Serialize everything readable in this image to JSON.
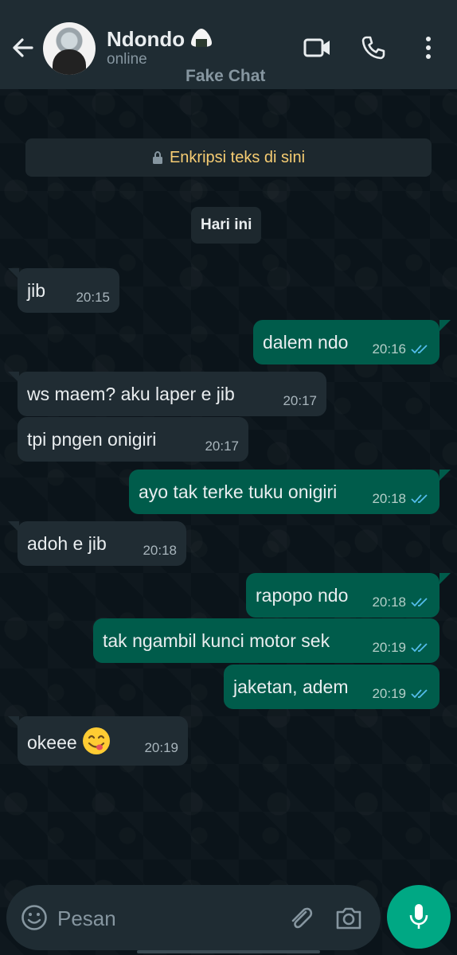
{
  "header": {
    "contact_name": "Ndondo",
    "status": "online",
    "app_title": "Fake Chat",
    "icons": [
      "back-arrow-icon",
      "video-call-icon",
      "phone-icon",
      "more-vert-icon"
    ]
  },
  "chat": {
    "encryption_notice": "Enkripsi teks di sini",
    "date_label": "Hari ini",
    "messages": [
      {
        "dir": "in",
        "text": "jib",
        "time": "20:15"
      },
      {
        "dir": "out",
        "text": "dalem ndo",
        "time": "20:16",
        "status": "read"
      },
      {
        "dir": "in",
        "text": "ws maem? aku laper e jib",
        "time": "20:17"
      },
      {
        "dir": "in",
        "text": "tpi pngen onigiri",
        "time": "20:17"
      },
      {
        "dir": "out",
        "text": "ayo tak terke tuku onigiri",
        "time": "20:18",
        "status": "read"
      },
      {
        "dir": "in",
        "text": "adoh e jib",
        "time": "20:18"
      },
      {
        "dir": "out",
        "text": "rapopo ndo",
        "time": "20:18",
        "status": "read"
      },
      {
        "dir": "out",
        "text": "tak ngambil kunci motor sek",
        "time": "20:19",
        "status": "read"
      },
      {
        "dir": "out",
        "text": "jaketan, adem",
        "time": "20:19",
        "status": "read"
      },
      {
        "dir": "in",
        "text": "okeee",
        "time": "20:19",
        "emoji": "yum-face"
      }
    ]
  },
  "composer": {
    "placeholder": "Pesan",
    "icons": [
      "emoji-icon",
      "attach-icon",
      "camera-icon",
      "mic-icon"
    ]
  },
  "colors": {
    "background": "#0b141a",
    "header": "#1f2c33",
    "incoming_bubble": "#202c33",
    "outgoing_bubble": "#005c4b",
    "read_ticks": "#53bdeb",
    "accent": "#00a884",
    "encryption_text": "#f7cd73"
  }
}
